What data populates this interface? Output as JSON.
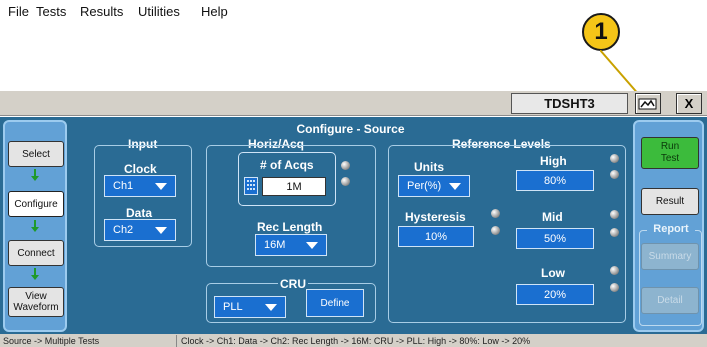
{
  "callout": {
    "number": "1"
  },
  "menu": {
    "items": [
      "File",
      "Tests",
      "Results",
      "Utilities",
      "Help"
    ]
  },
  "instrument": {
    "id": "TDSHT3"
  },
  "window_buttons": {
    "close": "X"
  },
  "left_nav": {
    "select": "Select",
    "configure": "Configure",
    "connect": "Connect",
    "view_waveform_line1": "View",
    "view_waveform_line2": "Waveform"
  },
  "right_panel": {
    "run_test_line1": "Run",
    "run_test_line2": "Test",
    "result": "Result",
    "report_label": "Report",
    "summary": "Summary",
    "detail": "Detail"
  },
  "configure": {
    "title": "Configure - Source",
    "input": {
      "title": "Input",
      "clock_label": "Clock",
      "clock_value": "Ch1",
      "data_label": "Data",
      "data_value": "Ch2"
    },
    "horiz_acq": {
      "title": "Horiz/Acq",
      "acqs_label": "# of Acqs",
      "acqs_value": "1M",
      "rec_length_label": "Rec Length",
      "rec_length_value": "16M"
    },
    "cru": {
      "title": "CRU",
      "value": "PLL",
      "define": "Define"
    },
    "reference_levels": {
      "title": "Reference Levels",
      "units_label": "Units",
      "units_value": "Per(%)",
      "hysteresis_label": "Hysteresis",
      "hysteresis_value": "10%",
      "high_label": "High",
      "high_value": "80%",
      "mid_label": "Mid",
      "mid_value": "50%",
      "low_label": "Low",
      "low_value": "20%"
    }
  },
  "status": {
    "left": "Source -> Multiple Tests",
    "right": "Clock -> Ch1: Data -> Ch2: Rec Length -> 16M: CRU -> PLL: High -> 80%: Low -> 20%"
  },
  "colors": {
    "panel_bg": "#2a6b94",
    "side_bg": "#62a1d6",
    "dropdown_bg": "#1a6fd0",
    "run_green": "#3cbb3c",
    "callout_yellow": "#f5c518"
  }
}
